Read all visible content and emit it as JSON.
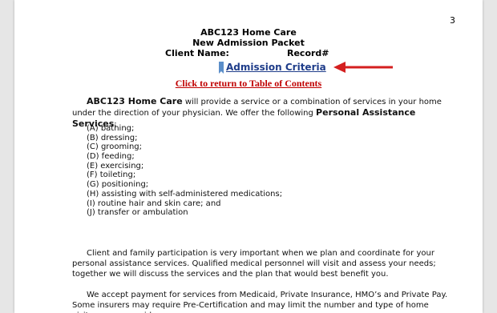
{
  "page_number": "3",
  "header": {
    "company": "ABC123 Home Care",
    "packet": "New Admission Packet",
    "client_name_label": "Client Name:",
    "record_label": "Record#"
  },
  "section_link": "Admission Criteria",
  "toc_link": "Click to return to Table of Contents",
  "intro": {
    "company_bold": "ABC123 Home Care",
    "text1": " will provide a service or a combination of services in your home under the direction of your physician.  We offer the following ",
    "services_bold": "Personal Assistance Services",
    "text2": ":"
  },
  "services": [
    "(A) bathing;",
    "(B) dressing;",
    "(C) grooming;",
    "(D) feeding;",
    "(E) exercising;",
    "(F) toileting;",
    "(G) positioning;",
    "(H) assisting with self-administered medications;",
    "(I) routine hair and skin care; and",
    "(J) transfer or ambulation"
  ],
  "paragraph2": "Client and family participation is very important when we plan and coordinate for your personal assistance services. Qualified medical personnel will visit and assess your needs; together we will discuss the services and the plan that would best benefit you.",
  "paragraph3": "We accept payment for services from Medicaid, Private Insurance, HMO’s and Private Pay. Some insurers may require Pre-Certification and may limit the number and type of home visits we can provide.",
  "colors": {
    "link_blue": "#1f3d8a",
    "toc_red": "#c00000",
    "arrow_red": "#d41f1f"
  }
}
